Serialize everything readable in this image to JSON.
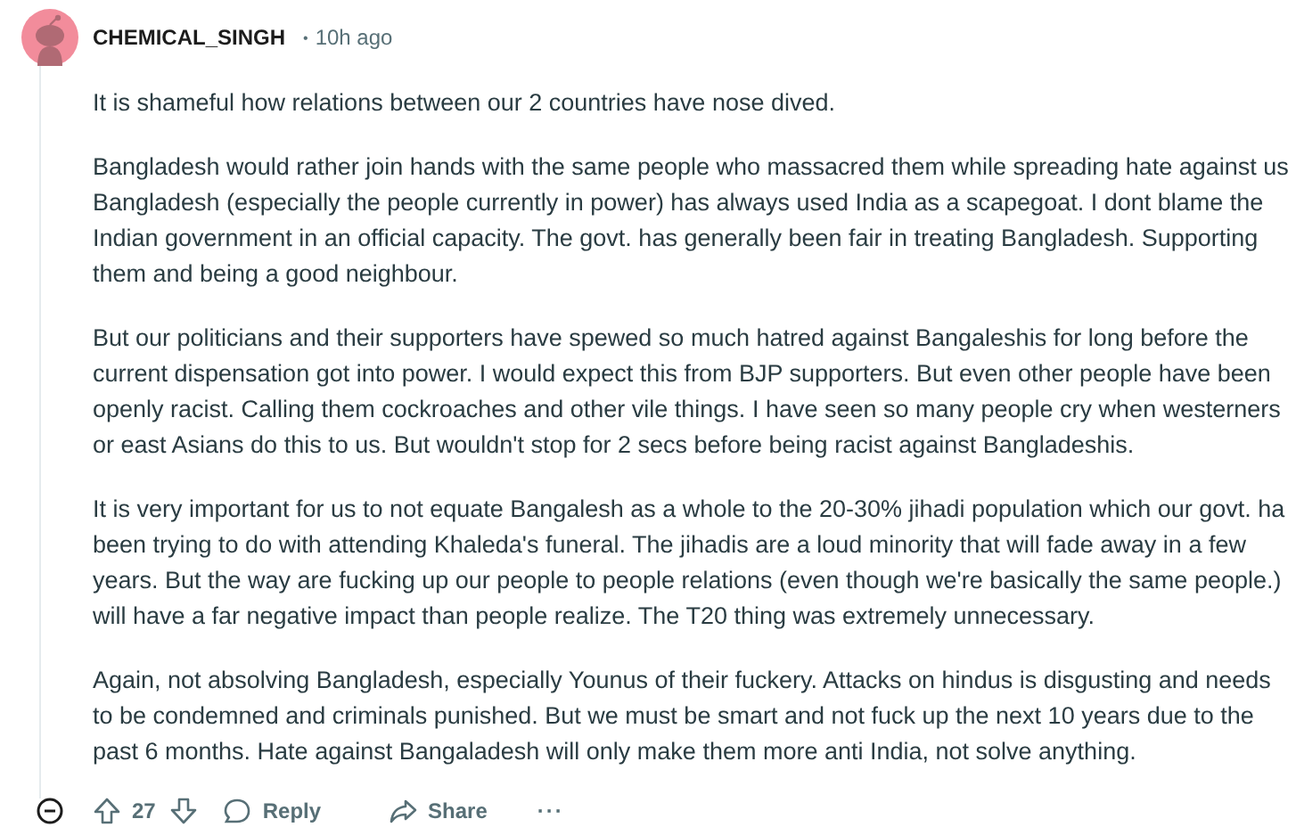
{
  "comment": {
    "author": "CHEMICAL_SINGH",
    "separator": "•",
    "time": "10h ago",
    "paragraphs": [
      [
        "It is shameful how relations between our 2 countries have nose dived."
      ],
      [
        "Bangladesh would rather join hands with the same people who massacred them while spreading hate against us",
        "Bangladesh (especially the people currently in power) has always used India as a scapegoat. I dont blame the",
        "Indian government in an official capacity. The govt. has generally been fair in treating Bangladesh. Supporting",
        "them and being a good neighbour."
      ],
      [
        "But our politicians and their supporters have spewed so much hatred against Bangaleshis for long before the",
        "current dispensation got into power. I would expect this from BJP supporters. But even other people have been",
        "openly racist. Calling them cockroaches and other vile things. I have seen so many people cry when westerners",
        "or east Asians do this to us. But wouldn't stop for 2 secs before being racist against Bangladeshis."
      ],
      [
        "It is very important for us to not equate Bangalesh as a whole to the 20-30% jihadi population which our govt. ha",
        "been trying to do with attending Khaleda's funeral. The jihadis are a loud minority that will fade away in a few",
        "years. But the way are fucking up our people to people relations (even though we're basically the same people.)",
        "will have a far negative impact than people realize. The T20 thing was extremely unnecessary."
      ],
      [
        "Again, not absolving Bangladesh, especially Younus of their fuckery. Attacks on hindus is disgusting and needs",
        "to be condemned and criminals punished. But we must be smart and not fuck up the next 10 years due to the",
        "past 6 months. Hate against Bangaladesh will only make them more anti India, not solve anything."
      ]
    ],
    "actions": {
      "score": "27",
      "reply": "Reply",
      "share": "Share",
      "more": "···"
    }
  }
}
